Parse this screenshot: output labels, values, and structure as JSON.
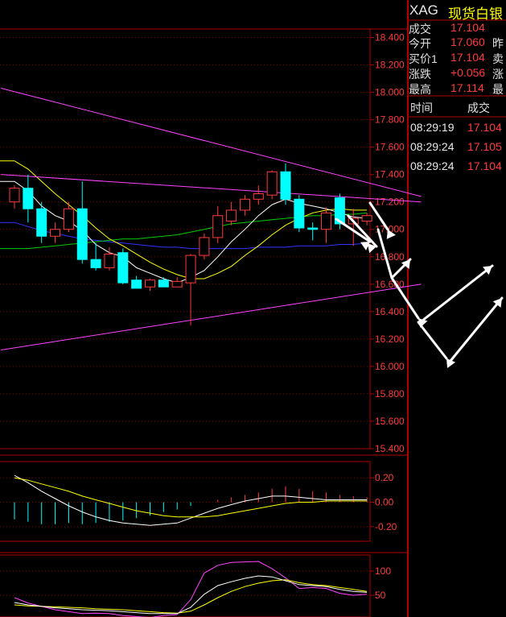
{
  "header": {
    "code": "XAG",
    "name": "现货白银"
  },
  "quote": [
    {
      "label": "成交",
      "value": "17.104",
      "extra": ""
    },
    {
      "label": "今开",
      "value": "17.060",
      "extra": "昨"
    },
    {
      "label": "买价1",
      "value": "17.104",
      "extra": "卖"
    },
    {
      "label": "涨跌",
      "value": "+0.056",
      "extra": "涨"
    },
    {
      "label": "最高",
      "value": "17.114",
      "extra": "最"
    }
  ],
  "ticks": {
    "headers": [
      "时间",
      "成交"
    ],
    "rows": [
      {
        "time": "08:29:19",
        "price": "17.104"
      },
      {
        "time": "08:29:24",
        "price": "17.105"
      },
      {
        "time": "08:29:24",
        "price": "17.104"
      }
    ]
  },
  "colors": {
    "up": "#ff3b3b",
    "down": "#00ffff",
    "grid": "#8b0000",
    "ma5": "#ffffff",
    "ma10": "#ffff00",
    "ma20": "#00cc00",
    "ma60": "#3333ff",
    "trend": "#ff44ff"
  },
  "chart_data": [
    {
      "type": "candlestick",
      "ylim": [
        15.4,
        18.45
      ],
      "y_ticks": [
        "18.400",
        "18.200",
        "18.000",
        "17.800",
        "17.600",
        "17.400",
        "17.200",
        "17.000",
        "16.800",
        "16.600",
        "16.400",
        "16.200",
        "16.000",
        "15.800",
        "15.600",
        "15.400"
      ],
      "y_tick_values": [
        18.4,
        18.2,
        18.0,
        17.8,
        17.6,
        17.4,
        17.2,
        17.0,
        16.8,
        16.6,
        16.4,
        16.2,
        16.0,
        15.8,
        15.6,
        15.4
      ],
      "candles": [
        {
          "o": 17.2,
          "h": 17.32,
          "c": 17.3,
          "l": 17.15
        },
        {
          "o": 17.3,
          "h": 17.4,
          "c": 17.15,
          "l": 17.05
        },
        {
          "o": 17.15,
          "h": 17.2,
          "c": 16.95,
          "l": 16.9
        },
        {
          "o": 16.95,
          "h": 17.05,
          "c": 17.0,
          "l": 16.9
        },
        {
          "o": 17.0,
          "h": 17.2,
          "c": 17.15,
          "l": 16.98
        },
        {
          "o": 17.15,
          "h": 17.35,
          "c": 16.78,
          "l": 16.75
        },
        {
          "o": 16.78,
          "h": 16.9,
          "c": 16.72,
          "l": 16.7
        },
        {
          "o": 16.72,
          "h": 16.87,
          "c": 16.82,
          "l": 16.7
        },
        {
          "o": 16.83,
          "h": 16.86,
          "c": 16.61,
          "l": 16.6
        },
        {
          "o": 16.63,
          "h": 16.66,
          "c": 16.57,
          "l": 16.57
        },
        {
          "o": 16.58,
          "h": 16.64,
          "c": 16.63,
          "l": 16.55
        },
        {
          "o": 16.63,
          "h": 16.65,
          "c": 16.58,
          "l": 16.58
        },
        {
          "o": 16.58,
          "h": 16.65,
          "c": 16.62,
          "l": 16.58
        },
        {
          "o": 16.61,
          "h": 16.82,
          "c": 16.81,
          "l": 16.3
        },
        {
          "o": 16.81,
          "h": 16.97,
          "c": 16.94,
          "l": 16.78
        },
        {
          "o": 16.94,
          "h": 17.17,
          "c": 17.1,
          "l": 16.9
        },
        {
          "o": 17.06,
          "h": 17.2,
          "c": 17.14,
          "l": 17.03
        },
        {
          "o": 17.14,
          "h": 17.25,
          "c": 17.22,
          "l": 17.1
        },
        {
          "o": 17.22,
          "h": 17.32,
          "c": 17.26,
          "l": 17.18
        },
        {
          "o": 17.25,
          "h": 17.43,
          "c": 17.42,
          "l": 17.22
        },
        {
          "o": 17.42,
          "h": 17.48,
          "c": 17.22,
          "l": 17.18
        },
        {
          "o": 17.22,
          "h": 17.25,
          "c": 17.01,
          "l": 16.98
        },
        {
          "o": 17.01,
          "h": 17.05,
          "c": 17.0,
          "l": 16.92
        },
        {
          "o": 17.0,
          "h": 17.16,
          "c": 17.12,
          "l": 16.9
        },
        {
          "o": 17.23,
          "h": 17.26,
          "c": 17.04,
          "l": 17.0
        },
        {
          "o": 17.04,
          "h": 17.15,
          "c": 17.08,
          "l": 16.88
        },
        {
          "o": 17.06,
          "h": 17.12,
          "c": 17.1,
          "l": 17.03
        }
      ],
      "ma5": [
        17.35,
        17.28,
        17.17,
        17.1,
        17.06,
        16.99,
        16.89,
        16.83,
        16.8,
        16.72,
        16.68,
        16.64,
        16.61,
        16.65,
        16.7,
        16.8,
        16.91,
        17.0,
        17.1,
        17.18,
        17.22,
        17.19,
        17.17,
        17.15,
        17.12,
        17.09,
        17.08
      ],
      "ma10": [
        17.5,
        17.44,
        17.35,
        17.26,
        17.18,
        17.1,
        17.01,
        16.93,
        16.88,
        16.82,
        16.76,
        16.71,
        16.67,
        16.64,
        16.64,
        16.68,
        16.73,
        16.81,
        16.88,
        16.96,
        17.03,
        17.08,
        17.12,
        17.14,
        17.15,
        17.14,
        17.14
      ],
      "ma20": [
        16.86,
        16.86,
        16.87,
        16.88,
        16.89,
        16.9,
        16.91,
        16.92,
        16.93,
        16.93,
        16.94,
        16.95,
        16.96,
        16.98,
        17.0,
        17.02,
        17.04,
        17.05,
        17.06,
        17.07,
        17.08,
        17.09,
        17.1,
        17.1,
        17.11,
        17.11,
        17.12
      ],
      "ma60": [
        17.05,
        17.02,
        16.99,
        16.97,
        16.95,
        16.93,
        16.92,
        16.91,
        16.9,
        16.89,
        16.88,
        16.87,
        16.87,
        16.86,
        16.86,
        16.86,
        16.86,
        16.86,
        16.87,
        16.87,
        16.87,
        16.88,
        16.88,
        16.88,
        16.89,
        16.89,
        16.9
      ],
      "trend_lines": [
        {
          "from": [
            -1,
            18.03
          ],
          "to": [
            30,
            17.24
          ]
        },
        {
          "from": [
            -1,
            16.12
          ],
          "to": [
            30,
            16.6
          ]
        },
        {
          "from": [
            -1,
            17.4
          ],
          "to": [
            30,
            17.2
          ]
        }
      ]
    },
    {
      "type": "bar",
      "ylim": [
        -0.32,
        0.32
      ],
      "y_ticks": [
        "0.20",
        "0.00",
        "-0.20"
      ],
      "y_tick_values": [
        0.2,
        0.0,
        -0.2
      ],
      "values": [
        -0.14,
        -0.16,
        -0.18,
        -0.18,
        -0.17,
        -0.18,
        -0.17,
        -0.16,
        -0.15,
        -0.13,
        -0.11,
        -0.08,
        -0.06,
        -0.03,
        0.0,
        0.02,
        0.04,
        0.06,
        0.08,
        0.11,
        0.13,
        0.11,
        0.09,
        0.08,
        0.06,
        0.05,
        0.04
      ],
      "dif": [
        0.22,
        0.16,
        0.09,
        0.03,
        -0.03,
        -0.08,
        -0.12,
        -0.15,
        -0.17,
        -0.18,
        -0.19,
        -0.18,
        -0.17,
        -0.13,
        -0.09,
        -0.05,
        -0.02,
        0.01,
        0.03,
        0.05,
        0.05,
        0.04,
        0.03,
        0.02,
        0.02,
        0.02,
        0.02
      ],
      "dea": [
        0.2,
        0.18,
        0.15,
        0.12,
        0.09,
        0.05,
        0.02,
        -0.01,
        -0.04,
        -0.07,
        -0.09,
        -0.11,
        -0.12,
        -0.12,
        -0.12,
        -0.11,
        -0.09,
        -0.07,
        -0.05,
        -0.03,
        -0.01,
        0.0,
        0.0,
        0.01,
        0.01,
        0.01,
        0.01
      ]
    },
    {
      "type": "line",
      "ylim": [
        5,
        130
      ],
      "y_ticks": [
        "100",
        "50"
      ],
      "y_tick_values": [
        100,
        50
      ],
      "k": [
        35,
        30,
        27,
        24,
        22,
        20,
        19,
        18,
        16,
        14,
        12,
        12,
        12,
        25,
        52,
        70,
        78,
        85,
        90,
        88,
        80,
        72,
        70,
        68,
        62,
        58,
        56
      ],
      "d": [
        30,
        28,
        27,
        26,
        25,
        24,
        22,
        21,
        20,
        18,
        16,
        14,
        13,
        17,
        30,
        45,
        58,
        68,
        75,
        80,
        82,
        76,
        72,
        70,
        66,
        62,
        58
      ],
      "j": [
        45,
        34,
        27,
        20,
        16,
        12,
        13,
        12,
        8,
        6,
        4,
        8,
        10,
        41,
        96,
        112,
        118,
        119,
        120,
        105,
        86,
        64,
        66,
        64,
        54,
        50,
        52
      ]
    }
  ]
}
